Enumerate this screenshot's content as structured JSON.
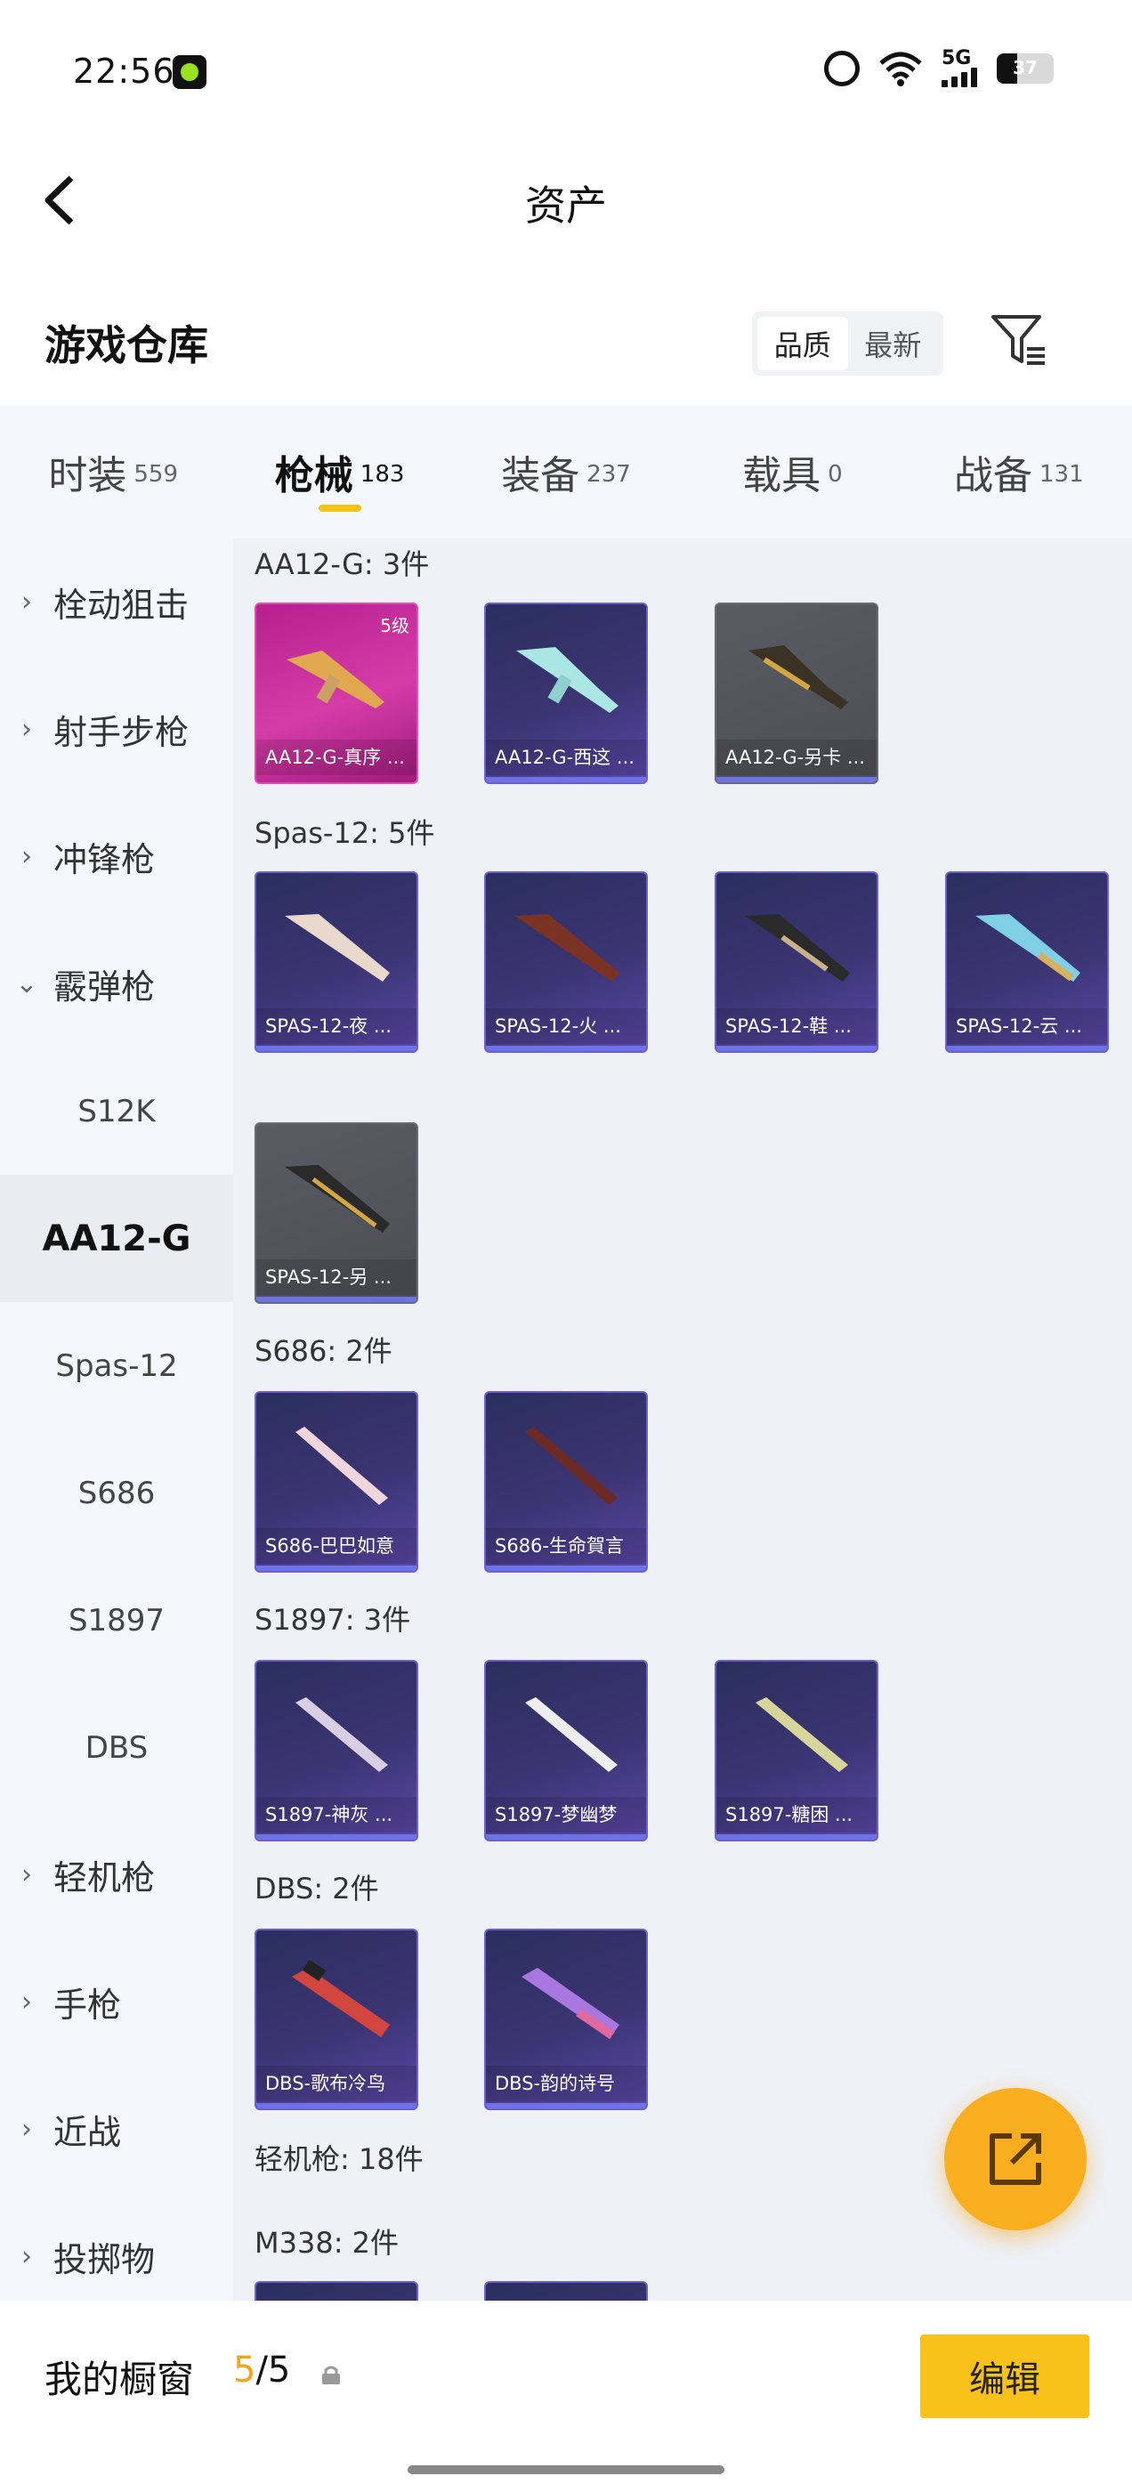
{
  "status_bar": {
    "time": "22:56",
    "network": "5G",
    "battery": "37",
    "icons": [
      "app-icon",
      "alarm-icon",
      "wifi-icon",
      "signal-icon",
      "battery-icon"
    ]
  },
  "header": {
    "title": "资产",
    "back_icon": "chevron-left-icon"
  },
  "warehouse": {
    "title": "游戏仓库",
    "sort_options": [
      "品质",
      "最新"
    ],
    "sort_selected": "品质",
    "filter_icon": "filter-icon"
  },
  "tabs": [
    {
      "label": "时装",
      "count": "559"
    },
    {
      "label": "枪械",
      "count": "183"
    },
    {
      "label": "装备",
      "count": "237"
    },
    {
      "label": "载具",
      "count": "0"
    },
    {
      "label": "战备",
      "count": "131"
    }
  ],
  "active_tab": "枪械",
  "sidebar": {
    "items": [
      {
        "label": "栓动狙击",
        "type": "category"
      },
      {
        "label": "射手步枪",
        "type": "category"
      },
      {
        "label": "冲锋枪",
        "type": "category"
      },
      {
        "label": "霰弹枪",
        "type": "category-open"
      },
      {
        "label": "S12K",
        "type": "sub"
      },
      {
        "label": "AA12-G",
        "type": "sub-selected"
      },
      {
        "label": "Spas-12",
        "type": "sub"
      },
      {
        "label": "S686",
        "type": "sub"
      },
      {
        "label": "S1897",
        "type": "sub"
      },
      {
        "label": "DBS",
        "type": "sub"
      },
      {
        "label": "轻机枪",
        "type": "category"
      },
      {
        "label": "手枪",
        "type": "category"
      },
      {
        "label": "近战",
        "type": "category"
      },
      {
        "label": "投掷物",
        "type": "category"
      }
    ]
  },
  "groups": [
    {
      "label": "AA12-G: 3件",
      "items": [
        {
          "name": "AA12-G-真序 ...",
          "rarity": "pink",
          "level": "5级"
        },
        {
          "name": "AA12-G-西这 ...",
          "rarity": "purple"
        },
        {
          "name": "AA12-G-另卡 ...",
          "rarity": "gray"
        }
      ]
    },
    {
      "label": "Spas-12: 5件",
      "items": [
        {
          "name": "SPAS-12-夜 ...",
          "rarity": "purple"
        },
        {
          "name": "SPAS-12-火 ...",
          "rarity": "purple"
        },
        {
          "name": "SPAS-12-鞋 ...",
          "rarity": "purple"
        },
        {
          "name": "SPAS-12-云 ...",
          "rarity": "purple"
        },
        {
          "name": "SPAS-12-另 ...",
          "rarity": "gray"
        }
      ]
    },
    {
      "label": "S686: 2件",
      "items": [
        {
          "name": "S686-巴巴如意",
          "rarity": "purple"
        },
        {
          "name": "S686-生命賀言",
          "rarity": "purple"
        }
      ]
    },
    {
      "label": "S1897: 3件",
      "items": [
        {
          "name": "S1897-神灰 ...",
          "rarity": "purple"
        },
        {
          "name": "S1897-梦幽梦",
          "rarity": "purple"
        },
        {
          "name": "S1897-糖困 ...",
          "rarity": "purple"
        }
      ]
    },
    {
      "label": "DBS: 2件",
      "items": [
        {
          "name": "DBS-歌布冷鸟",
          "rarity": "purple"
        },
        {
          "name": "DBS-韵的诗号",
          "rarity": "purple"
        }
      ]
    },
    {
      "label": "轻机枪: 18件",
      "items": []
    },
    {
      "label": "M338: 2件",
      "items": [
        {
          "name": "",
          "rarity": "purple"
        },
        {
          "name": "",
          "rarity": "purple"
        }
      ]
    }
  ],
  "showcase": {
    "title": "我的橱窗",
    "current": "5",
    "total": "/5",
    "lock_icon": "lock-icon",
    "edit_label": "编辑"
  },
  "fab_icon": "share-external-icon",
  "colors": {
    "accent": "#f5c312",
    "fab": "#f8ae1e",
    "purple_card": "#3c3473",
    "pink_card": "#d53ca8",
    "gray_card": "#55575e"
  }
}
